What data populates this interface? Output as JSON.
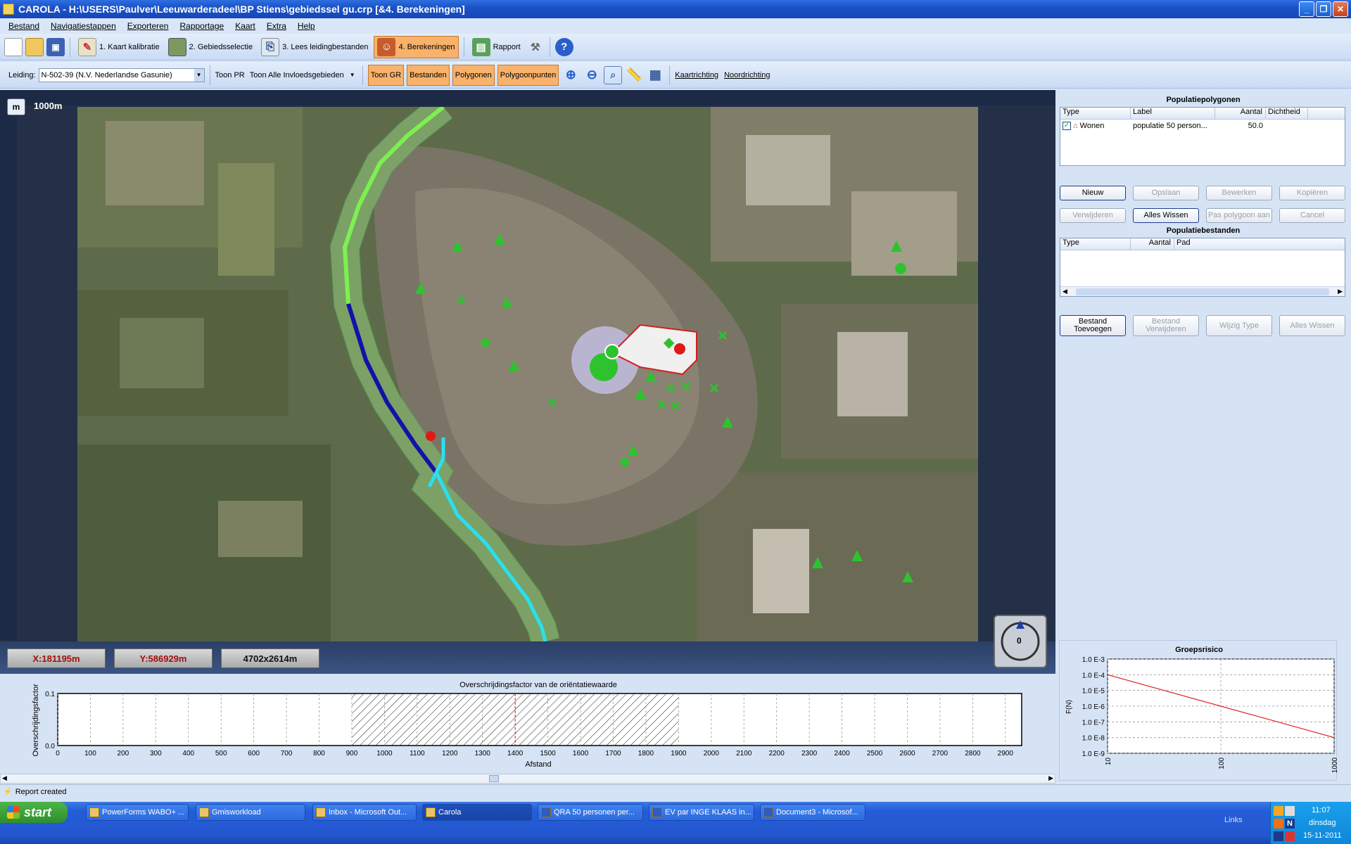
{
  "window": {
    "title": "CAROLA - H:\\USERS\\Paulver\\Leeuwarderadeel\\BP Stiens\\gebiedssel gu.crp [&4. Berekeningen]"
  },
  "menu": [
    "Bestand",
    "Navigatiestappen",
    "Exporteren",
    "Rapportage",
    "Kaart",
    "Extra",
    "Help"
  ],
  "toolbar1": {
    "step1": "1. Kaart kalibratie",
    "step2": "2. Gebiedsselectie",
    "step3": "3. Lees leidingbestanden",
    "step4": "4. Berekeningen",
    "rapport": "Rapport"
  },
  "toolbar2": {
    "leiding_label": "Leiding:",
    "leiding_value": "N-502-39 (N.V. Nederlandse Gasunie)",
    "toon_pr": "Toon PR",
    "invloed_value": "Toon Alle Invloedsgebieden",
    "toon_gr": "Toon GR",
    "bestanden": "Bestanden",
    "polygonen": "Polygonen",
    "polygoonpunten": "Polygoonpunten",
    "kaartrichting": "Kaartrichting",
    "noordrichting": "Noordrichting"
  },
  "map": {
    "scale_button": "m",
    "scale_text": "1000m",
    "coord_x": "X:181195m",
    "coord_y": "Y:586929m",
    "extent": "4702x2614m",
    "compass_value": "0"
  },
  "populatiepolygonen": {
    "title": "Populatiepolygonen",
    "columns": [
      "Type",
      "Label",
      "Aantal",
      "Dichtheid"
    ],
    "rows": [
      {
        "type": "Wonen",
        "label": "populatie 50 person...",
        "aantal": "50.0",
        "dichtheid": ""
      }
    ],
    "buttons": {
      "nieuw": "Nieuw",
      "opslaan": "Opslaan",
      "bewerken": "Bewerken",
      "kopieren": "Kopiëren",
      "verwijderen": "Verwijderen",
      "alles_wissen": "Alles Wissen",
      "pas_polygoon": "Pas polygoon aan",
      "cancel": "Cancel"
    }
  },
  "populatiebestanden": {
    "title": "Populatiebestanden",
    "columns": [
      "Type",
      "Aantal",
      "Pad"
    ],
    "buttons": {
      "bestand_toevoegen": "Bestand Toevoegen",
      "bestand_verwijderen": "Bestand Verwijderen",
      "wijzig_type": "Wijzig Type",
      "alles_wissen": "Alles Wissen"
    }
  },
  "chart_data": [
    {
      "type": "area",
      "title": "Overschrijdingsfactor van de oriëntatiewaarde",
      "xlabel": "Afstand",
      "ylabel": "Overschrijdingsfactor",
      "xlim": [
        0,
        2950
      ],
      "ylim": [
        0.0,
        0.1
      ],
      "x_ticks": [
        0,
        100,
        200,
        300,
        400,
        500,
        600,
        700,
        800,
        900,
        1000,
        1100,
        1200,
        1300,
        1400,
        1500,
        1600,
        1700,
        1800,
        1900,
        2000,
        2100,
        2200,
        2300,
        2400,
        2500,
        2600,
        2700,
        2800,
        2900
      ],
      "y_ticks": [
        "0.0",
        "0.1"
      ],
      "hatched_range": [
        900,
        1900
      ],
      "marker_x": 1400,
      "grid": true
    },
    {
      "type": "line",
      "title": "Groepsrisico",
      "ylabel": "F(N)",
      "x_scale": "log",
      "y_scale": "log",
      "x_ticks": [
        "10",
        "100",
        "1000"
      ],
      "y_ticks": [
        "1.0 E-3",
        "1.0 E-4",
        "1.0 E-5",
        "1.0 E-6",
        "1.0 E-7",
        "1.0 E-8",
        "1.0 E-9"
      ],
      "series": [
        {
          "x": [
            10,
            1000
          ],
          "y": [
            0.0001,
            1e-08
          ],
          "color": "#e02020"
        }
      ],
      "grid": true
    }
  ],
  "status": {
    "text": "Report created"
  },
  "taskbar": {
    "start": "start",
    "tasks": [
      "PowerForms WABO+ ...",
      "Gmisworkload",
      "Inbox - Microsoft Out...",
      "Carola",
      "QRA 50 personen per...",
      "EV par INGE KLAAS in...",
      "Document3 - Microsof..."
    ],
    "links": "Links",
    "time": "11:07",
    "day": "dinsdag",
    "date": "15-11-2011"
  }
}
